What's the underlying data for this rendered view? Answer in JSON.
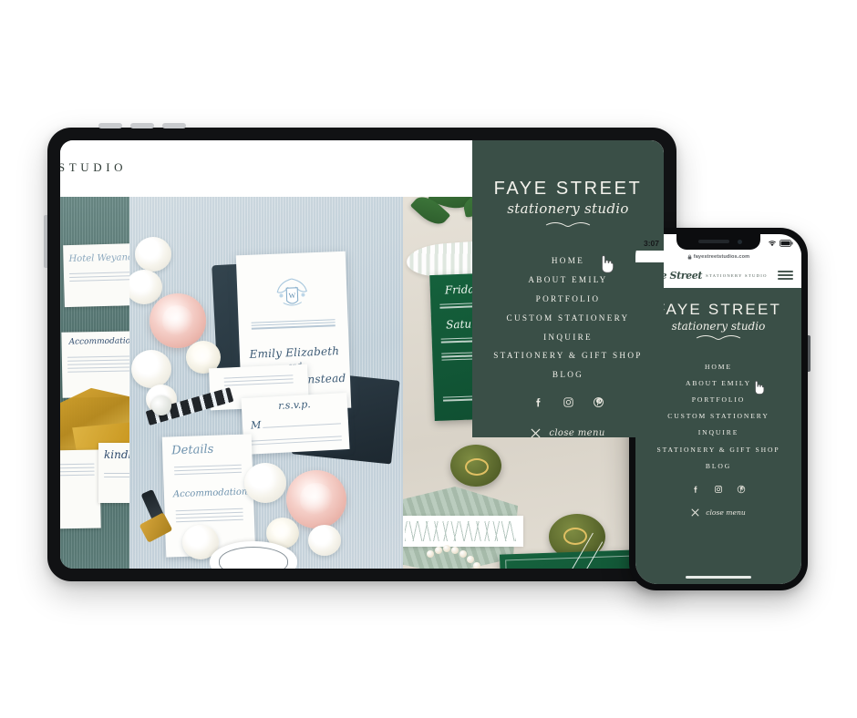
{
  "brand": {
    "name": "FAYE STREET",
    "tagline": "stationery studio",
    "script_logo": "Faye Street",
    "logo_subtitle": "STATIONERY STUDIO",
    "header_partial": "RY STUDIO",
    "accent_green": "#3a4f47"
  },
  "menu": {
    "items": [
      {
        "label": "HOME"
      },
      {
        "label": "ABOUT EMILY"
      },
      {
        "label": "PORTFOLIO"
      },
      {
        "label": "CUSTOM STATIONERY"
      },
      {
        "label": "INQUIRE"
      },
      {
        "label": "STATIONERY & GIFT SHOP"
      },
      {
        "label": "BLOG"
      }
    ],
    "socials": [
      {
        "name": "facebook-icon",
        "label": "Facebook"
      },
      {
        "name": "instagram-icon",
        "label": "Instagram"
      },
      {
        "name": "pinterest-icon",
        "label": "Pinterest"
      }
    ],
    "close_label": "close menu"
  },
  "phone": {
    "status": {
      "time": "3:07",
      "wifi": "wifi-icon",
      "battery": "battery-icon"
    },
    "url": "fayestreetstudios.com",
    "lock": "lock-icon"
  },
  "photos": {
    "center": {
      "names_line1": "Emily Elizabeth",
      "names_and": "and",
      "names_line2": "Andrew Winstead",
      "card_details": "Details",
      "card_accommodations": "Accommodations",
      "card_rsvp": "r.s.v.p.",
      "rsvp_m": "M"
    },
    "left": {
      "card_hotel": "Hotel Weyanoke",
      "card_accommodations": "Accommodations",
      "card_rsvp": "kindly"
    },
    "right": {
      "day_one": "Friday",
      "day_two": "Saturday"
    }
  },
  "cursor": {
    "name": "pointer-hand-cursor"
  }
}
